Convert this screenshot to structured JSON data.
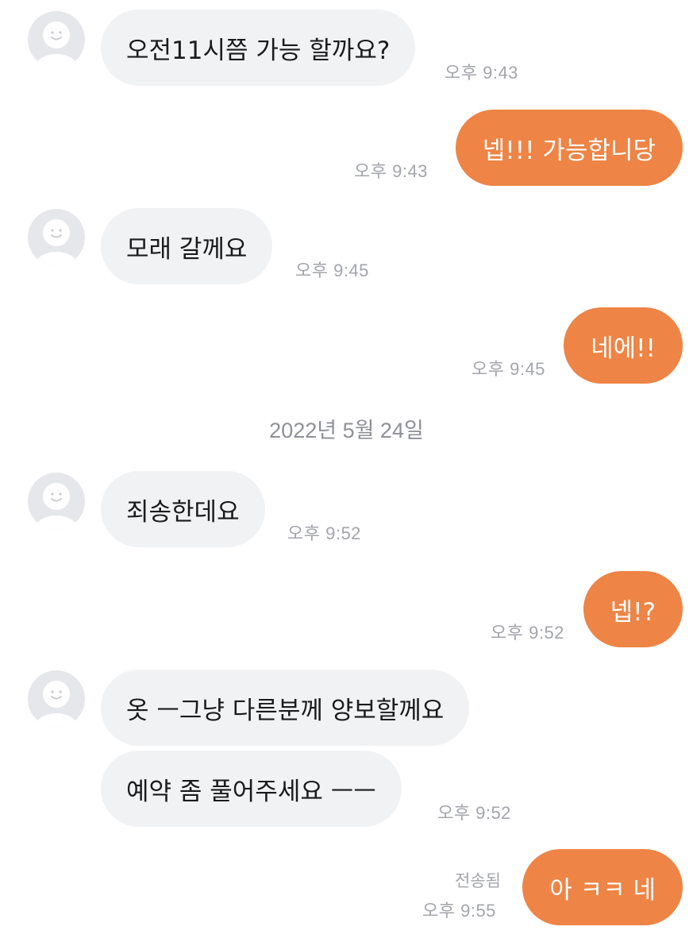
{
  "colors": {
    "outgoing_bubble": "#ee8445",
    "incoming_bubble": "#f1f2f4",
    "timestamp": "#a3a5ab"
  },
  "avatar_icon": "smiley-person-icon",
  "date_divider": "2022년 5월 24일",
  "messages": [
    {
      "direction": "incoming",
      "text": "오전11시쯤 가능 할까요?",
      "time": "오후 9:43"
    },
    {
      "direction": "outgoing",
      "text": "넵!!! 가능합니당",
      "time": "오후 9:43"
    },
    {
      "direction": "incoming",
      "text": "모래 갈께요",
      "time": "오후 9:45"
    },
    {
      "direction": "outgoing",
      "text": "네에!!",
      "time": "오후 9:45"
    },
    {
      "direction": "incoming",
      "text": "죄송한데요",
      "time": "오후 9:52"
    },
    {
      "direction": "outgoing",
      "text": "넵!?",
      "time": "오후 9:52"
    },
    {
      "direction": "incoming",
      "text": "옷 ㅡ그냥 다른분께 양보할께요"
    },
    {
      "direction": "incoming",
      "text": "예약 좀 풀어주세요 ㅡㅡ",
      "time": "오후 9:52"
    },
    {
      "direction": "outgoing",
      "text": "아 ㅋㅋ 네",
      "time": "오후 9:55",
      "status": "전송됨"
    }
  ]
}
